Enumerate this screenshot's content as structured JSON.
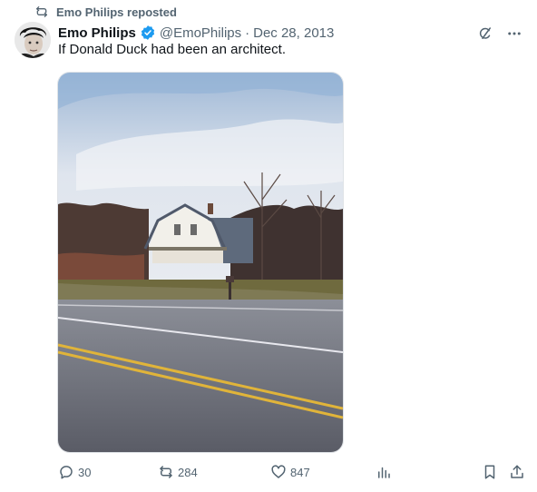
{
  "repost": {
    "label": "Emo Philips reposted",
    "icon": "repost-icon"
  },
  "author": {
    "name": "Emo Philips",
    "handle": "@EmoPhilips",
    "separator": "·",
    "date": "Dec 28, 2013",
    "verified": true
  },
  "tweet": {
    "text": "If Donald Duck had been an architect."
  },
  "header_actions": {
    "icons": [
      "grok-icon",
      "more-icon"
    ]
  },
  "actions": {
    "reply": {
      "count": "30",
      "icon": "reply-icon"
    },
    "repost": {
      "count": "284",
      "icon": "repost-icon"
    },
    "like": {
      "count": "847",
      "icon": "heart-icon"
    },
    "views": {
      "icon": "analytics-icon"
    },
    "bookmark": {
      "icon": "bookmark-icon"
    },
    "share": {
      "icon": "share-icon"
    }
  },
  "colors": {
    "text": "#0f1419",
    "secondary": "#536471",
    "verified": "#1d9bf0"
  }
}
